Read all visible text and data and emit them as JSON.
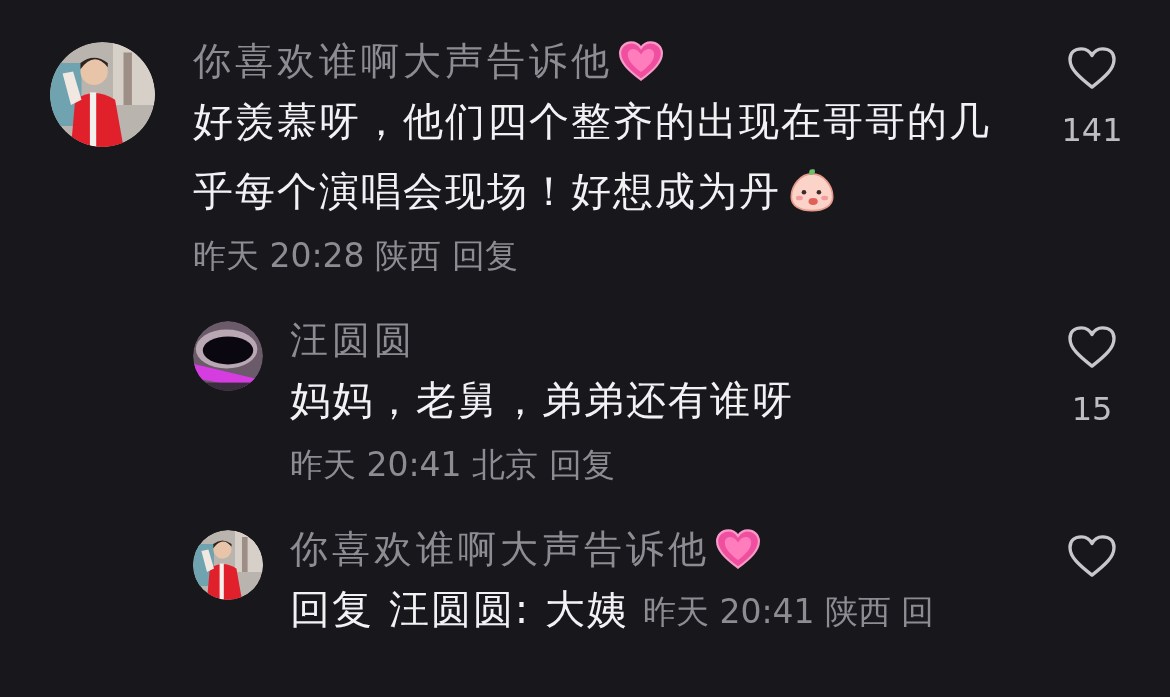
{
  "comments": [
    {
      "author": "你喜欢谁啊大声告诉他",
      "heart_badge": true,
      "text": "好羡慕呀，他们四个整齐的出现在哥哥的几乎每个演唱会现场！好想成为丹",
      "end_emoji": true,
      "meta": "昨天 20:28 陕西 回复",
      "meta_inline": false,
      "likes": "141",
      "children": [
        {
          "author": "汪圆圆",
          "heart_badge": false,
          "text": "妈妈，老舅，弟弟还有谁呀",
          "end_emoji": false,
          "meta": "昨天 20:41 北京 回复",
          "meta_inline": false,
          "likes": "15"
        },
        {
          "author": "你喜欢谁啊大声告诉他",
          "heart_badge": true,
          "text": "回复 汪圆圆: 大姨",
          "end_emoji": false,
          "meta": "昨天 20:41 陕西 回",
          "meta_inline": true
        }
      ]
    }
  ]
}
